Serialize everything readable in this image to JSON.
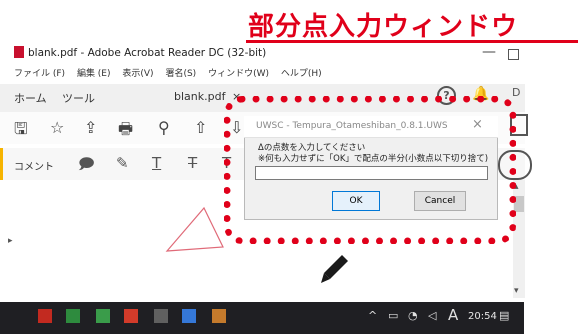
{
  "annotation": {
    "title": "部分点入力ウィンドウ",
    "color": "#e0001a"
  },
  "acrobat": {
    "window_title": "blank.pdf - Adobe Acrobat Reader DC (32-bit)",
    "menus": [
      "ファイル (F)",
      "編集 (E)",
      "表示(V)",
      "署名(S)",
      "ウィンドウ(W)",
      "ヘルプ(H)"
    ],
    "tabs": {
      "home": "ホーム",
      "tools": "ツール",
      "document": "blank.pdf",
      "close": "×"
    },
    "comment_label": "コメント",
    "user_hint": "D",
    "accent": "#f6b400"
  },
  "dialog": {
    "title": "UWSC - Tempura_Otameshiban_0.8.1.UWS",
    "close": "×",
    "message_line1": "Δの点数を入力してください",
    "message_line2": "※何も入力せずに「OK」で配点の半分(小数点以下切り捨て)",
    "input_value": "",
    "ok_label": "OK",
    "cancel_label": "Cancel"
  },
  "taskbar": {
    "tray_arrow": "^",
    "ime": "A",
    "time": "20:54"
  }
}
